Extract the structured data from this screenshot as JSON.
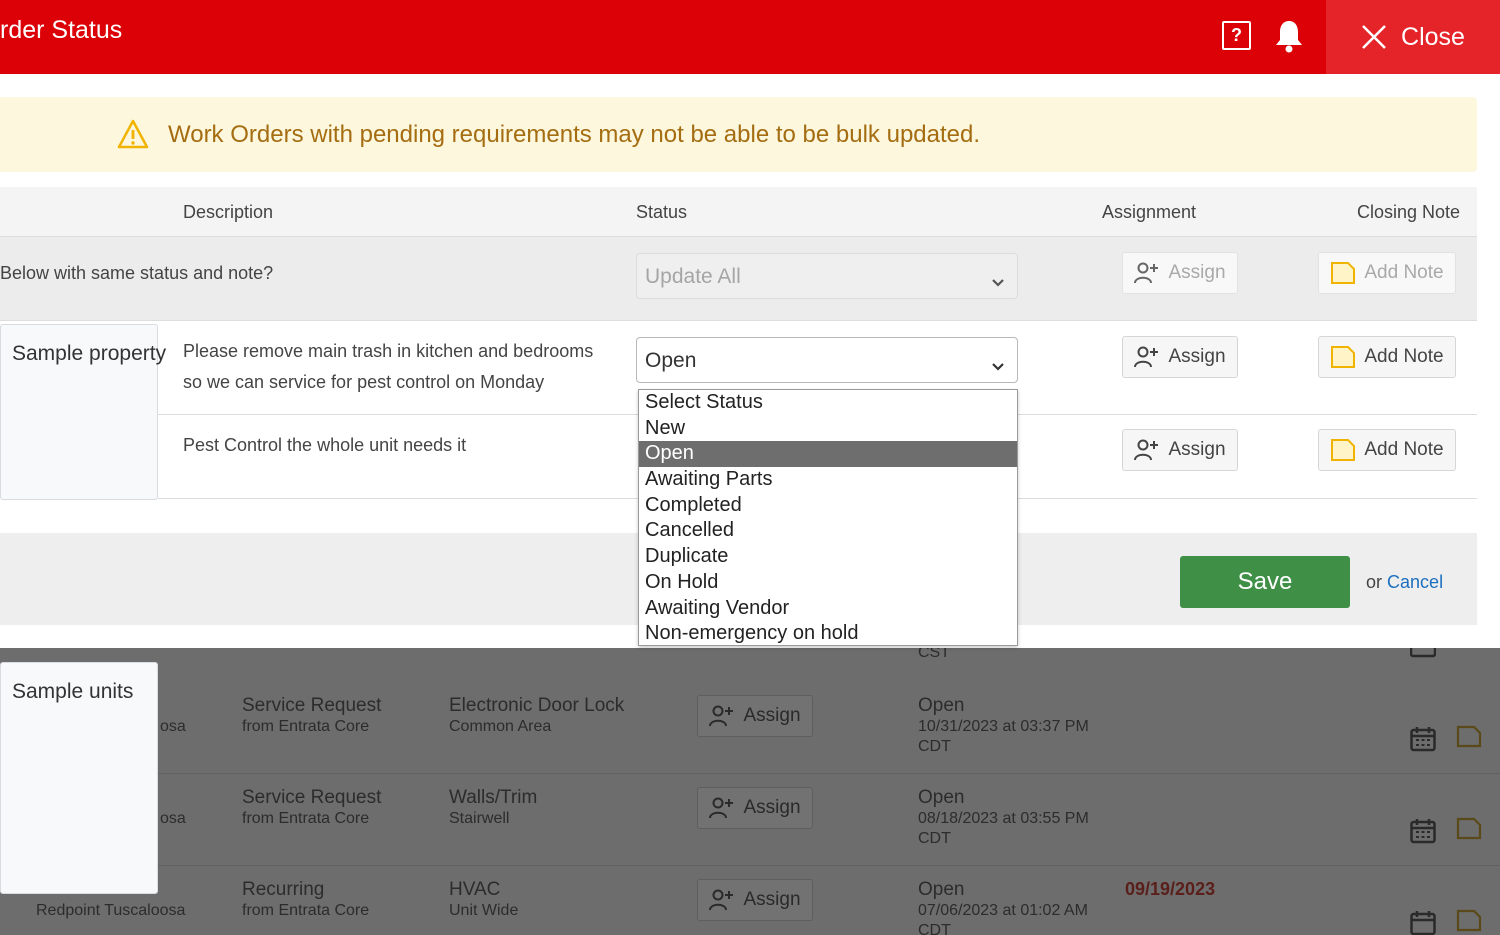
{
  "header": {
    "title": "rder Status",
    "help_glyph": "?",
    "close_label": "Close",
    "bg_color": "#dc0007"
  },
  "warning": {
    "text": "Work Orders with pending requirements may not be able to be bulk updated."
  },
  "table": {
    "columns": [
      "Description",
      "Status",
      "Assignment",
      "Closing Note"
    ],
    "bulk_row": {
      "question": "Below with same status and note?",
      "status_value": "Update All",
      "assign_label": "Assign",
      "note_label": "Add Note"
    },
    "rows": [
      {
        "description_lines": [
          "Please remove main trash in kitchen and bedrooms",
          "so we can service for pest control on Monday"
        ],
        "status_value": "Open",
        "assign_label": "Assign",
        "note_label": "Add Note"
      },
      {
        "description_lines": [
          "Pest Control the whole unit needs it"
        ],
        "status_value": "",
        "assign_label": "Assign",
        "note_label": "Add Note"
      }
    ]
  },
  "status_options": [
    "Select Status",
    "New",
    "Open",
    "Awaiting Parts",
    "Completed",
    "Cancelled",
    "Duplicate",
    "On Hold",
    "Awaiting Vendor",
    "Non-emergency on hold"
  ],
  "selected_option": "Open",
  "footer": {
    "save_label": "Save",
    "or_label": "or",
    "cancel_label": "Cancel"
  },
  "labels": {
    "property": "Sample property",
    "units": "Sample units"
  },
  "background_list": {
    "cst_fragment": "CST",
    "rows": [
      {
        "location_fragment": "osa",
        "type": "Service Request",
        "source": "from Entrata Core",
        "category": "Electronic Door Lock",
        "area": "Common Area",
        "assign_label": "Assign",
        "status": "Open",
        "created": "10/31/2023 at 03:37 PM",
        "tz": "CDT",
        "due": ""
      },
      {
        "location_fragment": "osa",
        "type": "Service Request",
        "source": "from Entrata Core",
        "category": "Walls/Trim",
        "area": "Stairwell",
        "assign_label": "Assign",
        "status": "Open",
        "created": "08/18/2023 at 03:55 PM",
        "tz": "CDT",
        "due": ""
      },
      {
        "location_fragment": "Redpoint Tuscaloosa",
        "type": "Recurring",
        "source": "from Entrata Core",
        "category": "HVAC",
        "area": "Unit Wide",
        "assign_label": "Assign",
        "status": "Open",
        "created": "07/06/2023 at 01:02 AM",
        "tz": "CDT",
        "due": "09/19/2023"
      }
    ]
  },
  "colors": {
    "brand_red": "#dc0007",
    "save_green": "#3f8f47",
    "warning_bg": "#fdf7dd",
    "warning_text": "#a56d12",
    "link_blue": "#1c6fbf",
    "due_red": "#5a1f1a"
  }
}
